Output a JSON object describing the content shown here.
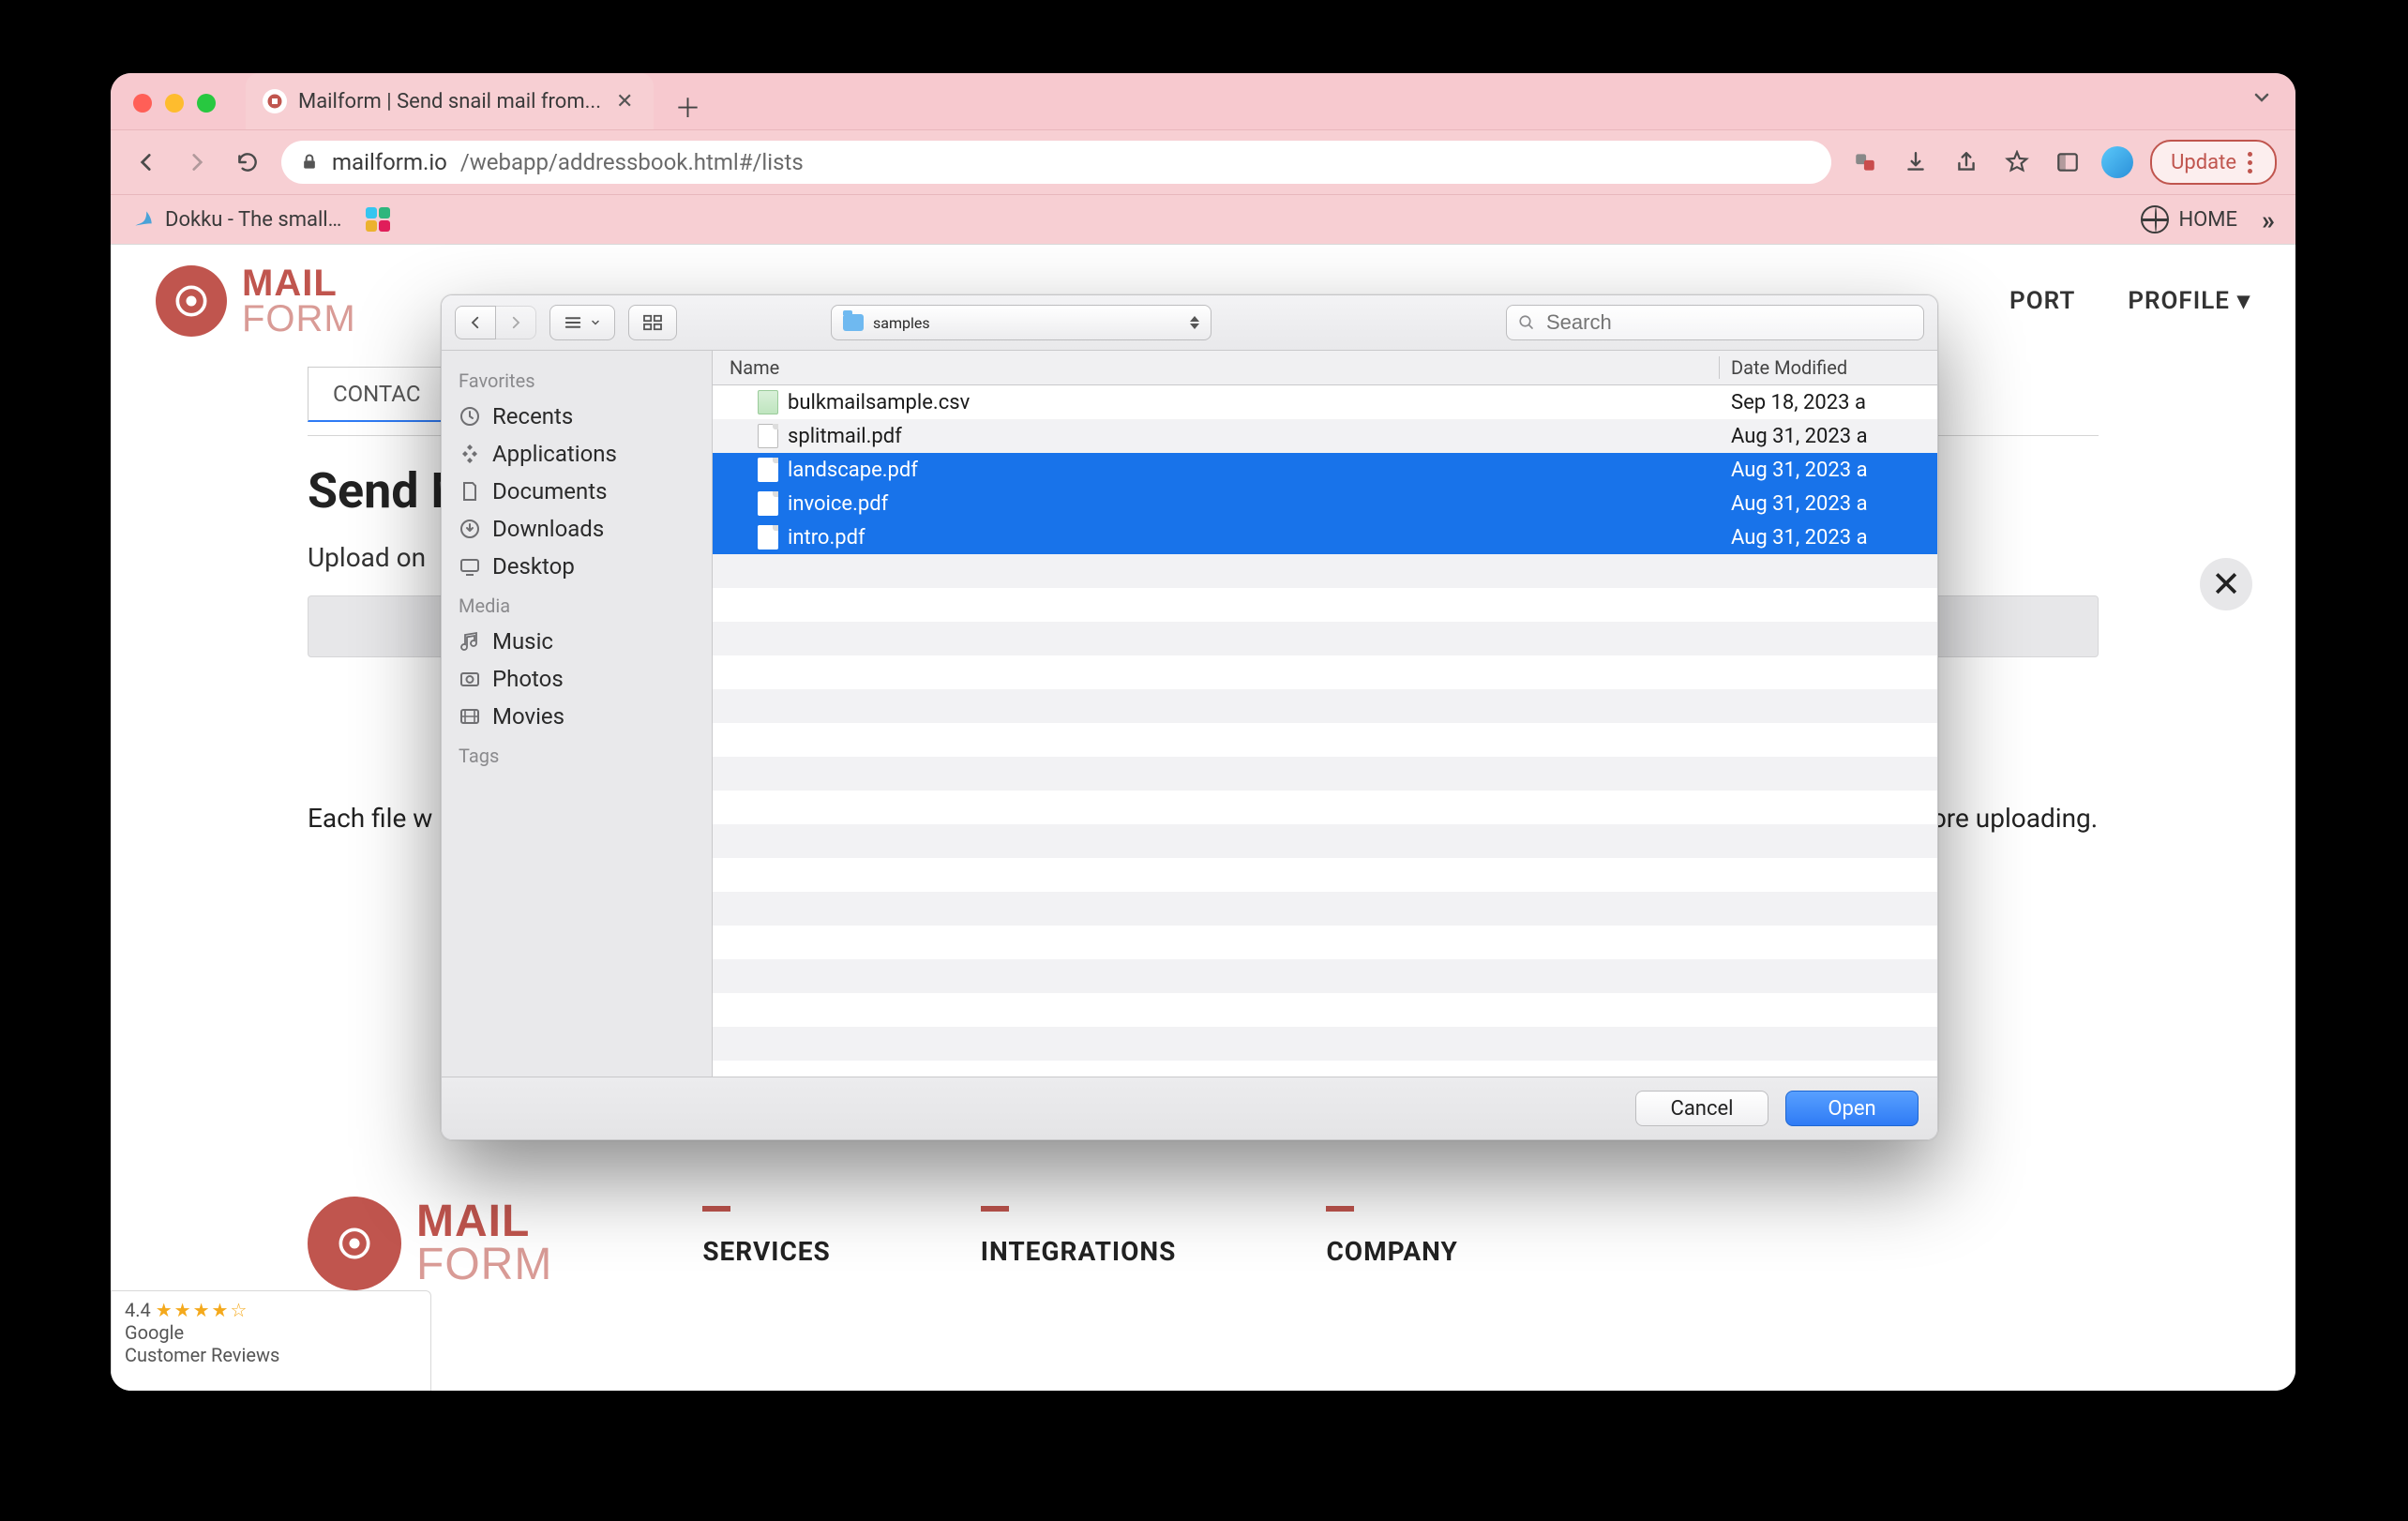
{
  "browser": {
    "tab_title": "Mailform | Send snail mail from...",
    "url_host": "mailform.io",
    "url_path": "/webapp/addressbook.html#/lists",
    "update_label": "Update"
  },
  "bookmarks": {
    "dokku": "Dokku - The small…",
    "home": "HOME"
  },
  "page": {
    "brand_top": "MAIL",
    "brand_bottom": "FORM",
    "nav_support": "PORT",
    "nav_profile": "PROFILE",
    "content_tab": "CONTAC",
    "heading": "Send M",
    "subheading": "Upload on",
    "help_prefix": "Each file w",
    "help_suffix": "efore uploading.",
    "close_x": "✕"
  },
  "footer": {
    "services": "SERVICES",
    "integrations": "INTEGRATIONS",
    "company": "COMPANY",
    "brand_top": "MAIL",
    "brand_bottom": "FORM"
  },
  "reviews": {
    "rating": "4.4",
    "line1": "Google",
    "line2": "Customer Reviews"
  },
  "dialog": {
    "folder_label": "samples",
    "search_placeholder": "Search",
    "col_name": "Name",
    "col_date": "Date Modified",
    "sidebar": {
      "favorites_hdr": "Favorites",
      "media_hdr": "Media",
      "tags_hdr": "Tags",
      "favorites": [
        {
          "label": "Recents"
        },
        {
          "label": "Applications"
        },
        {
          "label": "Documents"
        },
        {
          "label": "Downloads"
        },
        {
          "label": "Desktop"
        }
      ],
      "media": [
        {
          "label": "Music"
        },
        {
          "label": "Photos"
        },
        {
          "label": "Movies"
        }
      ]
    },
    "files": [
      {
        "name": "bulkmailsample.csv",
        "modified": "Sep 18, 2023 a",
        "selected": false,
        "kind": "csv"
      },
      {
        "name": "splitmail.pdf",
        "modified": "Aug 31, 2023 a",
        "selected": false,
        "kind": "pdf"
      },
      {
        "name": "landscape.pdf",
        "modified": "Aug 31, 2023 a",
        "selected": true,
        "kind": "pdf"
      },
      {
        "name": "invoice.pdf",
        "modified": "Aug 31, 2023 a",
        "selected": true,
        "kind": "pdf"
      },
      {
        "name": "intro.pdf",
        "modified": "Aug 31, 2023 a",
        "selected": true,
        "kind": "pdf"
      }
    ],
    "cancel_label": "Cancel",
    "open_label": "Open"
  }
}
